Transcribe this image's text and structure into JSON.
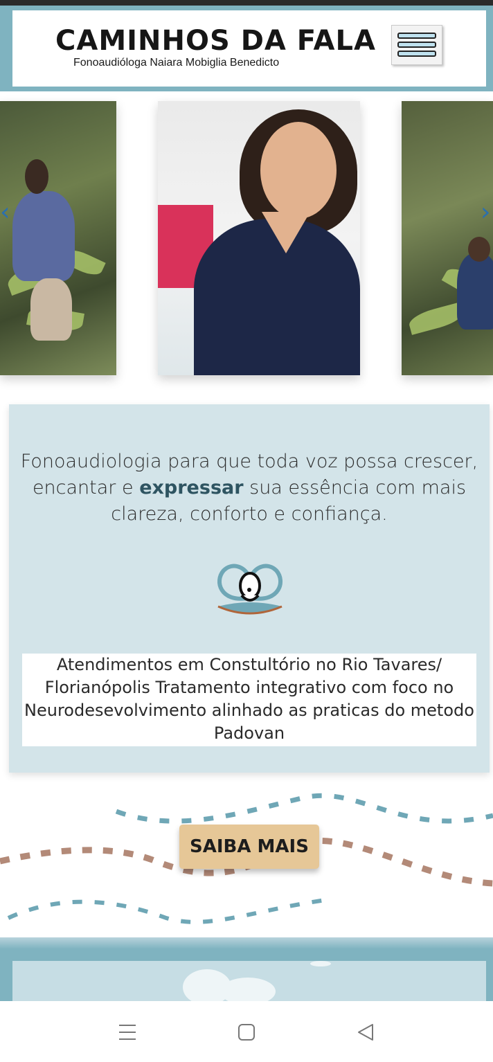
{
  "header": {
    "title": "CAMINHOS DA FALA",
    "subtitle": "Fonoaudióloga Naiara Mobiglia Benedicto",
    "menu_icon": "hamburger-menu-icon"
  },
  "carousel": {
    "prev_icon": "chevron-left-icon",
    "next_icon": "chevron-right-icon",
    "slides": [
      "forest-photo-woman",
      "portrait-photo-therapist",
      "forest-photo-man"
    ]
  },
  "intro": {
    "line_pre": "Fonoaudiologia para que toda voz possa crescer, encantar e ",
    "line_strong": "expressar",
    "line_post": " sua essência com mais clareza, conforto e confiança.",
    "logo_icon": "brand-logo-icon",
    "info": "Atendimentos em Constultório no Rio Tavares/ Florianópolis Tratamento integrativo com foco no Neurodesevolvimento alinhado as praticas do metodo Padovan"
  },
  "cta": {
    "label": "SAIBA MAIS"
  },
  "colors": {
    "accent": "#7fb3c0",
    "panel": "#d3e4e9",
    "button": "#e6c797",
    "brand_dark": "#2e5461",
    "dash_blue": "#6fa7b6",
    "dash_brown": "#b38a78"
  },
  "system_nav": {
    "recents_icon": "recents-icon",
    "home_icon": "home-icon",
    "back_icon": "back-icon"
  }
}
